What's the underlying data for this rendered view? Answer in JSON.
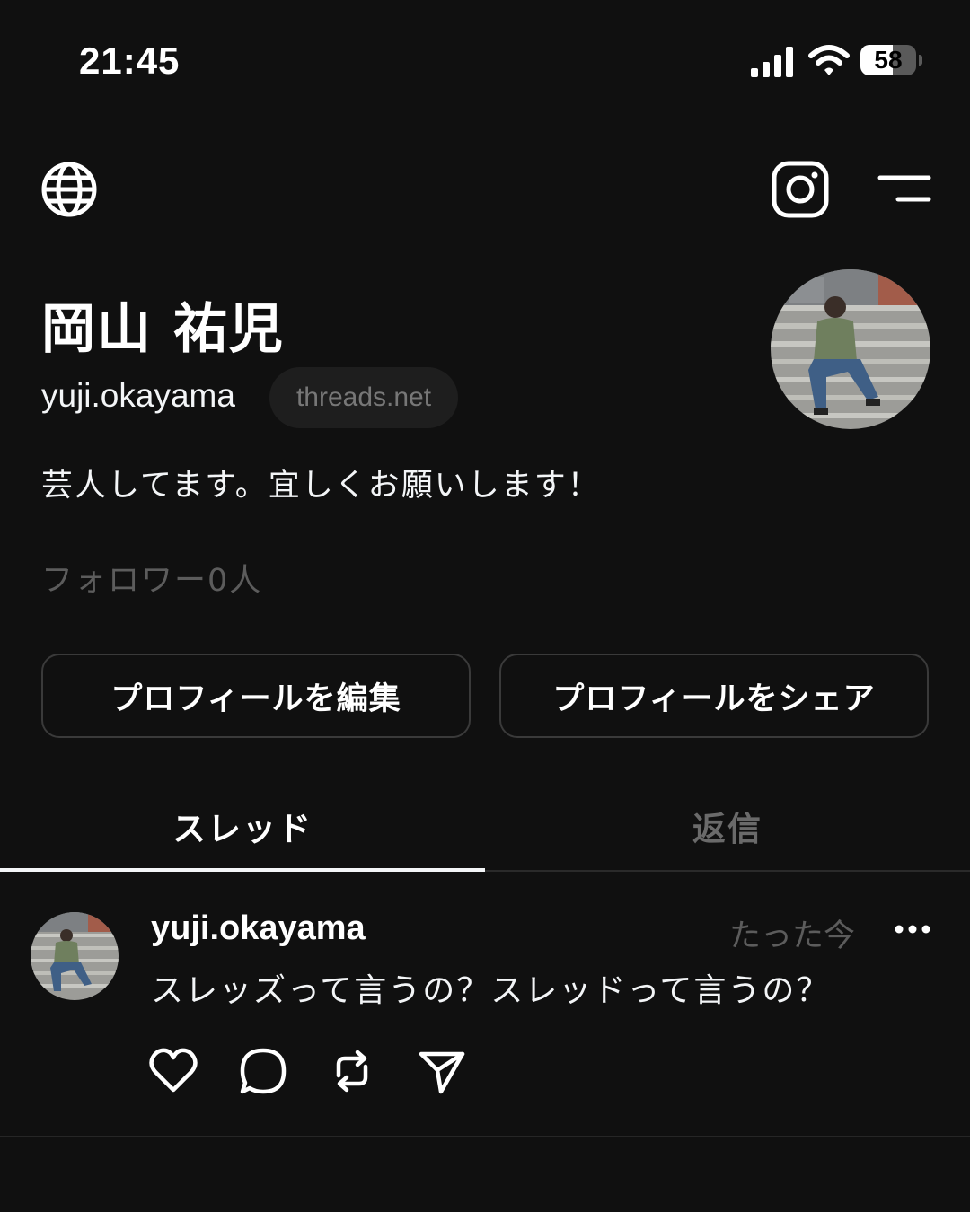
{
  "status_bar": {
    "time": "21:45",
    "battery": "58",
    "battery_level": 0.58,
    "icons": [
      "signal-icon",
      "wifi-icon",
      "battery-icon"
    ]
  },
  "nav": {
    "icons": [
      "globe-icon",
      "instagram-icon",
      "menu-icon"
    ]
  },
  "profile": {
    "display_name": "岡山 祐児",
    "username": "yuji.okayama",
    "domain": "threads.net",
    "bio": "芸人してます。宜しくお願いします！",
    "followers": "フォロワー0人",
    "edit_button": "プロフィールを編集",
    "share_button": "プロフィールをシェア"
  },
  "tabs": [
    {
      "label": "スレッド",
      "active": true
    },
    {
      "label": "返信",
      "active": false
    }
  ],
  "post": {
    "username": "yuji.okayama",
    "time": "たった今",
    "text": "スレッズって言うの？スレッドって言うの？",
    "actions": [
      "heart-icon",
      "comment-icon",
      "repost-icon",
      "send-icon"
    ]
  },
  "colors": {
    "background": "#101010",
    "text": "#f3f5f7",
    "muted": "#5c5c5c",
    "border": "#3a3a3a"
  }
}
